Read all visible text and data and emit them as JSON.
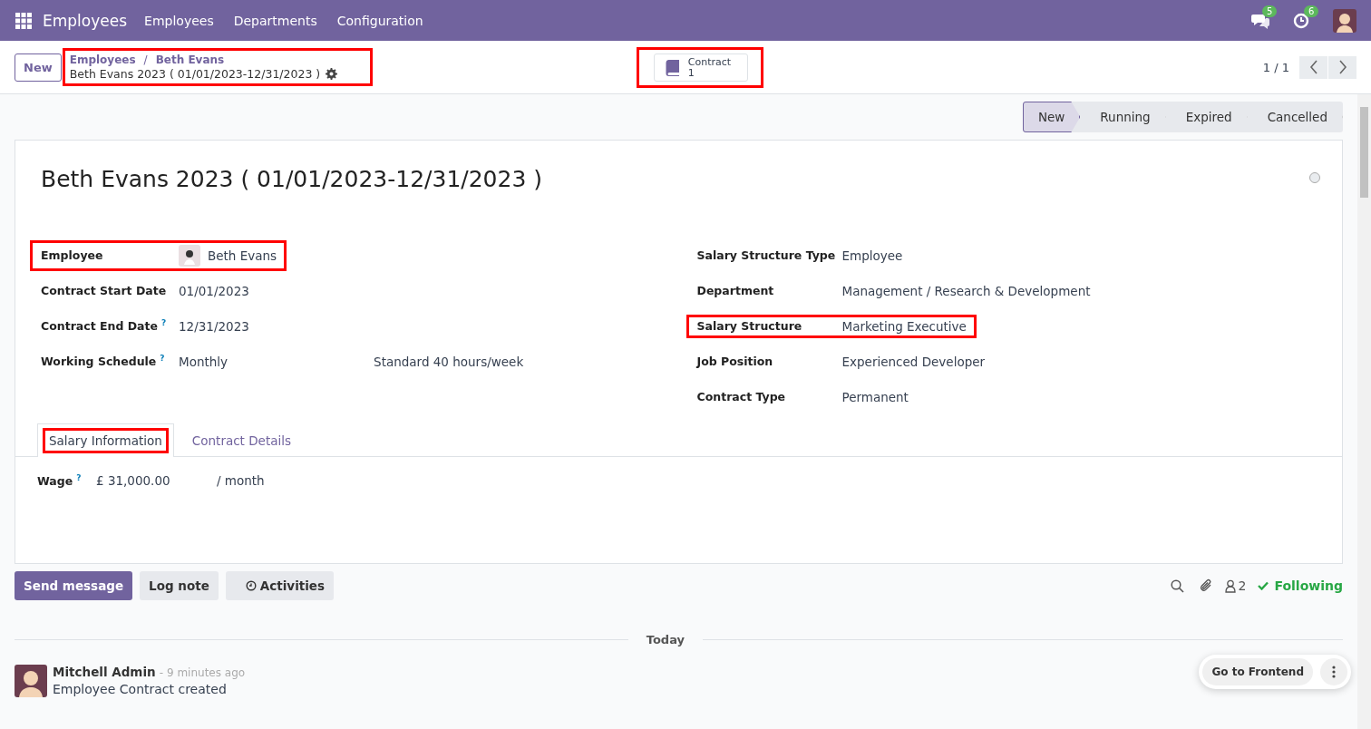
{
  "navbar": {
    "app_name": "Employees",
    "menu": [
      "Employees",
      "Departments",
      "Configuration"
    ],
    "messages_count": "5",
    "activities_count": "6"
  },
  "control_panel": {
    "new_button": "New",
    "breadcrumb": {
      "parent": "Employees",
      "separator": "/",
      "current_parent": "Beth Evans",
      "record": "Beth Evans 2023 ( 01/01/2023-12/31/2023 )",
      "highlighted": true
    },
    "smart_button": {
      "label": "Contract",
      "count": "1",
      "highlighted": true
    },
    "pager": "1 / 1"
  },
  "statusbar": [
    {
      "label": "New",
      "selected": true
    },
    {
      "label": "Running",
      "selected": false
    },
    {
      "label": "Expired",
      "selected": false
    },
    {
      "label": "Cancelled",
      "selected": false
    }
  ],
  "form": {
    "title": "Beth Evans 2023 ( 01/01/2023-12/31/2023 )",
    "left_fields": [
      {
        "label": "Employee",
        "value": "Beth Evans",
        "kind": "avatar",
        "highlighted": true
      },
      {
        "label": "Contract Start Date",
        "value": "01/01/2023",
        "kind": "text",
        "highlighted": false
      },
      {
        "label": "Contract End Date",
        "help": "?",
        "value": "12/31/2023",
        "kind": "text",
        "highlighted": false
      },
      {
        "label": "Working Schedule",
        "help": "?",
        "value": "Monthly",
        "extra": "Standard 40 hours/week",
        "kind": "text",
        "highlighted": false
      }
    ],
    "right_fields": [
      {
        "label": "Salary Structure Type",
        "value": "Employee",
        "highlighted": false
      },
      {
        "label": "Department",
        "value": "Management / Research & Development",
        "highlighted": false
      },
      {
        "label": "Salary Structure",
        "value": "Marketing Executive",
        "highlighted": true
      },
      {
        "label": "Job Position",
        "value": "Experienced Developer",
        "highlighted": false
      },
      {
        "label": "Contract Type",
        "value": "Permanent",
        "highlighted": false
      }
    ],
    "tabs": [
      {
        "label": "Salary Information",
        "selected": true,
        "highlighted": true
      },
      {
        "label": "Contract Details",
        "selected": false,
        "highlighted": false
      }
    ],
    "wage": {
      "label": "Wage",
      "help": "?",
      "value": "£ 31,000.00",
      "unit": "/ month"
    }
  },
  "chatter": {
    "buttons": [
      "Send message",
      "Log note",
      "Activities"
    ],
    "followers_count": "2",
    "following": "Following",
    "date_separator": "Today",
    "messages": [
      {
        "author": "Mitchell Admin",
        "time": "- 9 minutes ago",
        "body": "Employee Contract created"
      }
    ]
  },
  "frontend_button": "Go to Frontend"
}
